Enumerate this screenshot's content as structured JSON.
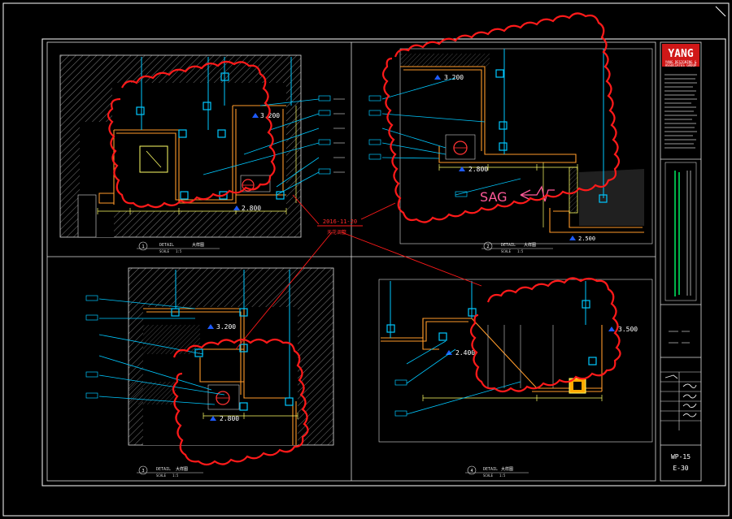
{
  "title_block": {
    "logo_text": "YANG",
    "firm_lines": [
      "YANG DESIGNING &",
      "ASSOCIATES GROUP"
    ],
    "sheet_number": "WP-15",
    "sheet_revision": "E-30"
  },
  "revision_note": {
    "date_text": "2016-11-20",
    "label_text": "天花调整"
  },
  "annotations": {
    "sag_text": "SAG"
  },
  "elevations": {
    "tl": "3.200",
    "tl_lower": "2.800",
    "tr": "3.200",
    "tr_lower": "2.800",
    "tr_floor": "2.500",
    "bl": "3.200",
    "bl_lower": "2.800",
    "br": "3.500",
    "br_lower": "2.400"
  },
  "details": [
    {
      "num": "1",
      "label": "DETAIL",
      "name": "大样图",
      "scale_label": "SCALE",
      "scale": "1:5"
    },
    {
      "num": "2",
      "label": "DETAIL",
      "name": "大样图",
      "scale_label": "SCALE",
      "scale": "1:5"
    },
    {
      "num": "3",
      "label": "DETAIL",
      "name": "大样图",
      "scale_label": "SCALE",
      "scale": "1:5"
    },
    {
      "num": "4",
      "label": "DETAIL",
      "name": "大样图",
      "scale_label": "SCALE",
      "scale": "1:5"
    }
  ],
  "colors": {
    "background": "#000000",
    "frame": "#ffffff",
    "cloud": "#ff1a1a",
    "leader": "#00c8ff",
    "wall": "#ff9a2a",
    "elevation_marker": "#1e5bff",
    "dimension": "#ffff66",
    "green_tb": "#00ff66",
    "hatch": "#8a8a8a"
  }
}
